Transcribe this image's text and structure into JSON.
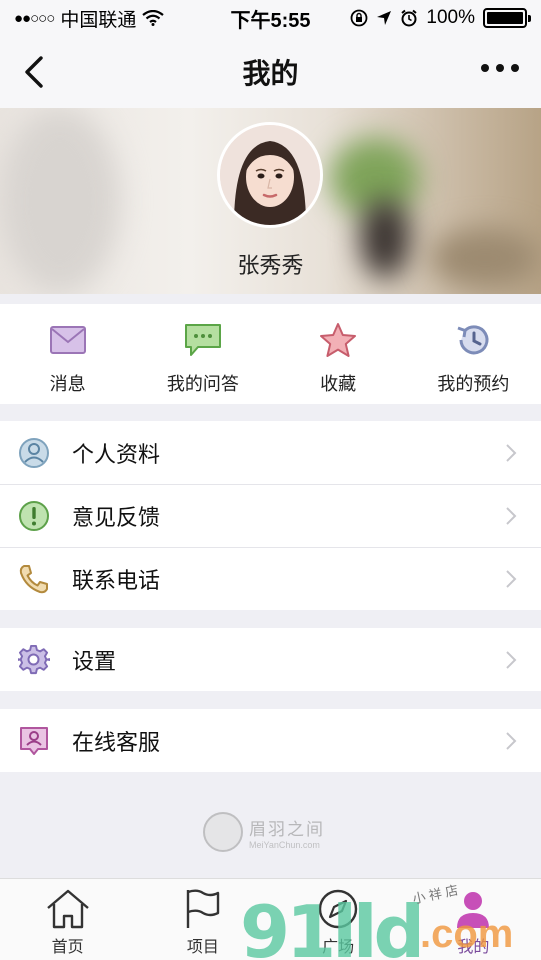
{
  "status_bar": {
    "carrier": "中国联通",
    "time": "下午5:55",
    "battery": "100%",
    "battery_level": 1.0
  },
  "nav": {
    "title": "我的"
  },
  "profile": {
    "name": "张秀秀"
  },
  "quick_actions": [
    {
      "label": "消息",
      "icon": "envelope-icon"
    },
    {
      "label": "我的问答",
      "icon": "chat-bubble-icon"
    },
    {
      "label": "收藏",
      "icon": "star-icon"
    },
    {
      "label": "我的预约",
      "icon": "history-clock-icon"
    }
  ],
  "menu_groups": {
    "group1": [
      {
        "label": "个人资料",
        "icon": "user-icon"
      },
      {
        "label": "意见反馈",
        "icon": "feedback-icon"
      },
      {
        "label": "联系电话",
        "icon": "phone-icon"
      }
    ],
    "group2": [
      {
        "label": "设置",
        "icon": "gear-icon"
      }
    ],
    "group3": [
      {
        "label": "在线客服",
        "icon": "support-icon"
      }
    ]
  },
  "watermark": {
    "brand_cn": "眉羽之间",
    "brand_en": "MeiYanChun.com"
  },
  "tab_bar": [
    {
      "label": "首页",
      "icon": "home-icon"
    },
    {
      "label": "项目",
      "icon": "flag-icon"
    },
    {
      "label": "广场",
      "icon": "compass-icon"
    },
    {
      "label": "我的",
      "icon": "profile-icon",
      "active": true
    }
  ],
  "overlay": {
    "logo": "91lld",
    "domain": ".com",
    "signature": "小 祥 店"
  },
  "colors": {
    "accent": "#7a4a9c",
    "background": "#efeff4"
  }
}
